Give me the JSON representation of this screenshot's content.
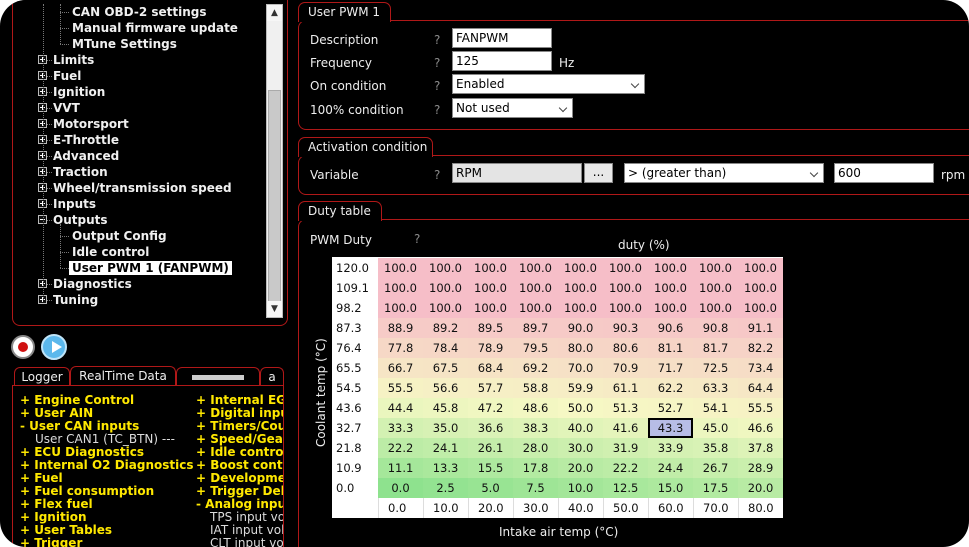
{
  "tree": {
    "items": [
      {
        "label": "CAN OBD-2 settings",
        "level": 2,
        "expander": "none",
        "selected": false
      },
      {
        "label": "Manual firmware update",
        "level": 2,
        "expander": "none",
        "selected": false
      },
      {
        "label": "MTune Settings",
        "level": 2,
        "expander": "none",
        "selected": false
      },
      {
        "label": "Limits",
        "level": 1,
        "expander": "plus",
        "selected": false
      },
      {
        "label": "Fuel",
        "level": 1,
        "expander": "plus",
        "selected": false
      },
      {
        "label": "Ignition",
        "level": 1,
        "expander": "plus",
        "selected": false
      },
      {
        "label": "VVT",
        "level": 1,
        "expander": "plus",
        "selected": false
      },
      {
        "label": "Motorsport",
        "level": 1,
        "expander": "plus",
        "selected": false
      },
      {
        "label": "E-Throttle",
        "level": 1,
        "expander": "plus",
        "selected": false
      },
      {
        "label": "Advanced",
        "level": 1,
        "expander": "plus",
        "selected": false
      },
      {
        "label": "Traction",
        "level": 1,
        "expander": "plus",
        "selected": false
      },
      {
        "label": "Wheel/transmission speed",
        "level": 1,
        "expander": "plus",
        "selected": false
      },
      {
        "label": "Inputs",
        "level": 1,
        "expander": "plus",
        "selected": false
      },
      {
        "label": "Outputs",
        "level": 1,
        "expander": "minus",
        "selected": false
      },
      {
        "label": "Output Config",
        "level": 2,
        "expander": "none",
        "selected": false
      },
      {
        "label": "Idle control",
        "level": 2,
        "expander": "none",
        "selected": false
      },
      {
        "label": "User PWM 1 (FANPWM)",
        "level": 2,
        "expander": "none",
        "selected": true
      },
      {
        "label": "Diagnostics",
        "level": 1,
        "expander": "plus",
        "selected": false
      },
      {
        "label": "Tuning",
        "level": 1,
        "expander": "plus",
        "selected": false
      }
    ]
  },
  "bottom_tabs": [
    {
      "label": "Logger",
      "active": false
    },
    {
      "label": "RealTime Data",
      "active": true
    },
    {
      "label": "",
      "active": false
    },
    {
      "label": "a",
      "active": false
    }
  ],
  "channels": {
    "left": [
      {
        "text": "+ Engine Control",
        "style": "y"
      },
      {
        "text": "+ User AIN",
        "style": "y"
      },
      {
        "text": "- User CAN inputs",
        "style": "y"
      },
      {
        "text": "User CAN1 (TC_BTN)   ---",
        "style": "g"
      },
      {
        "text": "+ ECU Diagnostics",
        "style": "y"
      },
      {
        "text": "+ Internal O2 Diagnostics",
        "style": "y"
      },
      {
        "text": "+ Fuel",
        "style": "y"
      },
      {
        "text": "+ Fuel consumption",
        "style": "y"
      },
      {
        "text": "+ Flex fuel",
        "style": "y"
      },
      {
        "text": "+ Ignition",
        "style": "y"
      },
      {
        "text": "+ User Tables",
        "style": "y"
      },
      {
        "text": "+ Trigger",
        "style": "y"
      }
    ],
    "right": [
      {
        "text": "+ Internal EGT",
        "style": "y"
      },
      {
        "text": "+ Digital inputs",
        "style": "y"
      },
      {
        "text": "+ Timers/Counters",
        "style": "y"
      },
      {
        "text": "+ Speed/Gear",
        "style": "y"
      },
      {
        "text": "+ Idle control",
        "style": "y"
      },
      {
        "text": "+ Boost control",
        "style": "y"
      },
      {
        "text": "+ Development",
        "style": "y"
      },
      {
        "text": "+ Trigger Delay",
        "style": "y"
      },
      {
        "text": "- Analog inputs",
        "style": "y"
      },
      {
        "text": "TPS input voltage",
        "style": "g"
      },
      {
        "text": "IAT input voltage",
        "style": "g"
      },
      {
        "text": "CLT input voltage",
        "style": "g"
      }
    ]
  },
  "pwm": {
    "tab": "User PWM 1",
    "description_label": "Description",
    "description_value": "FANPWM",
    "frequency_label": "Frequency",
    "frequency_value": "125",
    "frequency_unit": "Hz",
    "on_condition_label": "On condition",
    "on_condition_value": "Enabled",
    "full_condition_label": "100% condition",
    "full_condition_value": "Not used",
    "help_glyph": "?"
  },
  "activation": {
    "tab": "Activation condition",
    "variable_label": "Variable",
    "variable_value": "RPM",
    "browse_label": "...",
    "operator_value": "> (greater than)",
    "threshold_value": "600",
    "threshold_unit": "rpm"
  },
  "duty": {
    "tab": "Duty table",
    "name_label": "PWM Duty",
    "value_axis_title": "duty (%)",
    "x_axis_title": "Intake air temp (°C)",
    "y_axis_title": "Coolant temp (°C)",
    "highlight": [
      8,
      6
    ]
  },
  "chart_data": {
    "type": "heatmap",
    "title": "PWM Duty",
    "xlabel": "Intake air temp (°C)",
    "ylabel": "Coolant temp (°C)",
    "value_label": "duty (%)",
    "x": [
      "0.0",
      "10.0",
      "20.0",
      "30.0",
      "40.0",
      "50.0",
      "60.0",
      "70.0",
      "80.0"
    ],
    "y": [
      "120.0",
      "109.1",
      "98.2",
      "87.3",
      "76.4",
      "65.5",
      "54.5",
      "43.6",
      "32.7",
      "21.8",
      "10.9",
      "0.0"
    ],
    "values": [
      [
        "100.0",
        "100.0",
        "100.0",
        "100.0",
        "100.0",
        "100.0",
        "100.0",
        "100.0",
        "100.0"
      ],
      [
        "100.0",
        "100.0",
        "100.0",
        "100.0",
        "100.0",
        "100.0",
        "100.0",
        "100.0",
        "100.0"
      ],
      [
        "100.0",
        "100.0",
        "100.0",
        "100.0",
        "100.0",
        "100.0",
        "100.0",
        "100.0",
        "100.0"
      ],
      [
        "88.9",
        "89.2",
        "89.5",
        "89.7",
        "90.0",
        "90.3",
        "90.6",
        "90.8",
        "91.1"
      ],
      [
        "77.8",
        "78.4",
        "78.9",
        "79.5",
        "80.0",
        "80.6",
        "81.1",
        "81.7",
        "82.2"
      ],
      [
        "66.7",
        "67.5",
        "68.4",
        "69.2",
        "70.0",
        "70.9",
        "71.7",
        "72.5",
        "73.4"
      ],
      [
        "55.5",
        "56.6",
        "57.7",
        "58.8",
        "59.9",
        "61.1",
        "62.2",
        "63.3",
        "64.4"
      ],
      [
        "44.4",
        "45.8",
        "47.2",
        "48.6",
        "50.0",
        "51.3",
        "52.7",
        "54.1",
        "55.5"
      ],
      [
        "33.3",
        "35.0",
        "36.6",
        "38.3",
        "40.0",
        "41.6",
        "43.3",
        "45.0",
        "46.6"
      ],
      [
        "22.2",
        "24.1",
        "26.1",
        "28.0",
        "30.0",
        "31.9",
        "33.9",
        "35.8",
        "37.8"
      ],
      [
        "11.1",
        "13.3",
        "15.5",
        "17.8",
        "20.0",
        "22.2",
        "24.4",
        "26.7",
        "28.9"
      ],
      [
        "0.0",
        "2.5",
        "5.0",
        "7.5",
        "10.0",
        "12.5",
        "15.0",
        "17.5",
        "20.0"
      ]
    ]
  }
}
